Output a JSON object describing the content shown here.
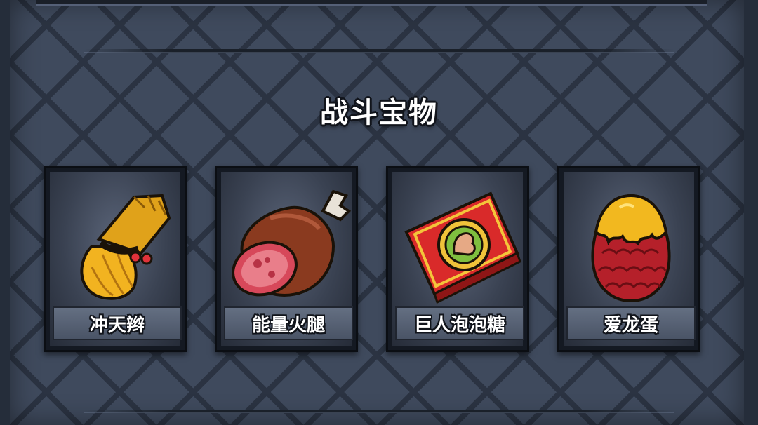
{
  "section": {
    "title": "战斗宝物"
  },
  "items": [
    {
      "name": "冲天辫",
      "icon": "ponytail-tuft-icon"
    },
    {
      "name": "能量火腿",
      "icon": "ham-icon"
    },
    {
      "name": "巨人泡泡糖",
      "icon": "bubblegum-box-icon"
    },
    {
      "name": "爱龙蛋",
      "icon": "dragon-egg-icon"
    }
  ],
  "colors": {
    "panel": "#3f4a5d",
    "grid": "#2b3342",
    "card": "#141922",
    "label_bar": "#56607a",
    "text": "#ffffff",
    "outline": "#11141b"
  }
}
